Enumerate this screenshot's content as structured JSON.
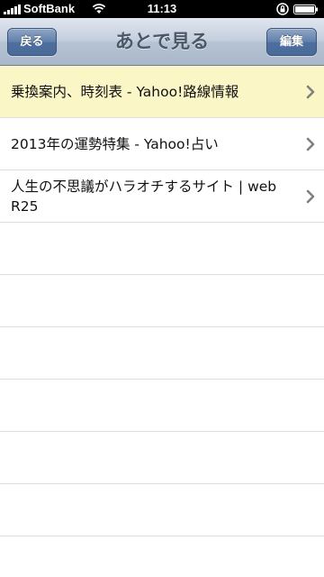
{
  "status_bar": {
    "carrier": "SoftBank",
    "time": "11:13"
  },
  "nav": {
    "back_label": "戻る",
    "title": "あとで見る",
    "edit_label": "編集"
  },
  "items": [
    {
      "label": "乗換案内、時刻表 - Yahoo!路線情報",
      "highlighted": true
    },
    {
      "label": "2013年の運勢特集 - Yahoo!占い",
      "highlighted": false
    },
    {
      "label": "人生の不思議がハラオチするサイト | web R25",
      "highlighted": false
    }
  ],
  "colors": {
    "highlight": "#fbf6c6",
    "nav_button": "#4d6f9f",
    "chevron": "#7f7f7f"
  },
  "icons": {
    "row_accessory": "chevron-right-icon",
    "status": [
      "signal-icon",
      "wifi-icon",
      "rotation-lock-icon",
      "battery-icon"
    ]
  }
}
